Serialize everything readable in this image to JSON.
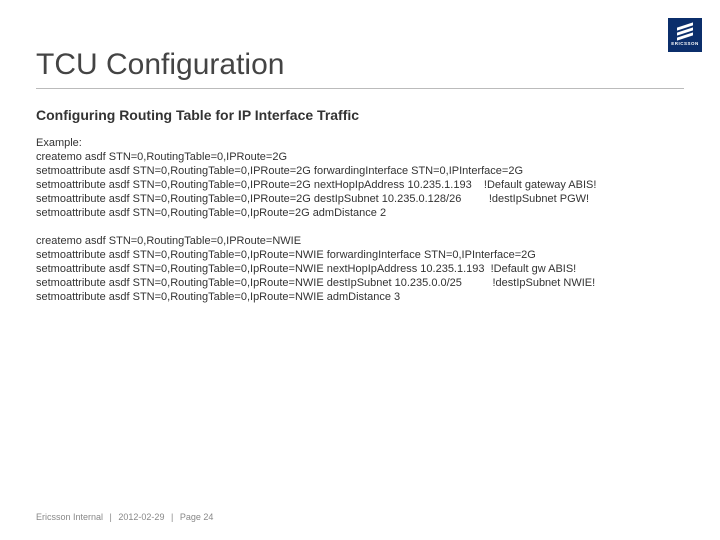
{
  "brand": {
    "name": "ERICSSON"
  },
  "title": "TCU Configuration",
  "subtitle": "Configuring Routing Table for IP Interface Traffic",
  "body_lines": [
    "Example:",
    "createmo asdf STN=0,RoutingTable=0,IPRoute=2G",
    "setmoattribute asdf STN=0,RoutingTable=0,IPRoute=2G forwardingInterface STN=0,IPInterface=2G",
    "setmoattribute asdf STN=0,RoutingTable=0,IPRoute=2G nextHopIpAddress 10.235.1.193    !Default gateway ABIS!",
    "setmoattribute asdf STN=0,RoutingTable=0,IPRoute=2G destIpSubnet 10.235.0.128/26         !destIpSubnet PGW!",
    "setmoattribute asdf STN=0,RoutingTable=0,IpRoute=2G admDistance 2",
    "",
    "createmo asdf STN=0,RoutingTable=0,IPRoute=NWIE",
    "setmoattribute asdf STN=0,RoutingTable=0,IpRoute=NWIE forwardingInterface STN=0,IPInterface=2G",
    "setmoattribute asdf STN=0,RoutingTable=0,IpRoute=NWIE nextHopIpAddress 10.235.1.193  !Default gw ABIS!",
    "setmoattribute asdf STN=0,RoutingTable=0,IpRoute=NWIE destIpSubnet 10.235.0.0/25          !destIpSubnet NWIE!",
    "setmoattribute asdf STN=0,RoutingTable=0,IpRoute=NWIE admDistance 3"
  ],
  "footer": {
    "classification": "Ericsson Internal",
    "date": "2012-02-29",
    "page_label": "Page",
    "page_number": "24"
  }
}
